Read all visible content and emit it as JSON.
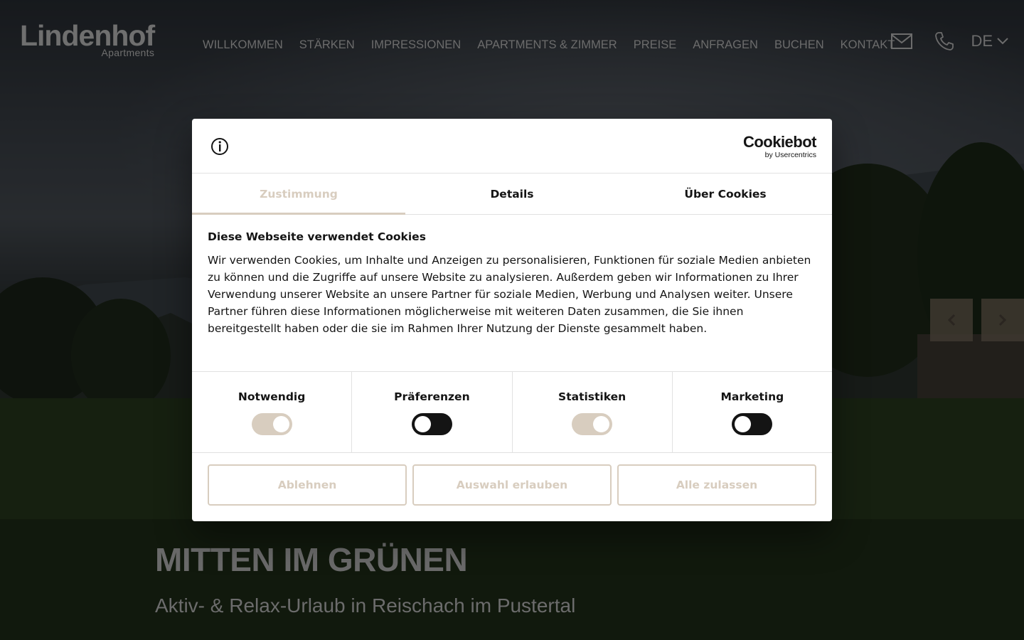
{
  "header": {
    "logo_main": "Lindenhof",
    "logo_sub": "Apartments",
    "nav": [
      "WILLKOMMEN",
      "STÄRKEN",
      "IMPRESSIONEN",
      "APARTMENTS & ZIMMER",
      "PREISE",
      "ANFRAGEN",
      "BUCHEN",
      "KONTAKT"
    ],
    "language": "DE"
  },
  "hero": {
    "title": "MITTEN IM GRÜNEN",
    "subtitle": "Aktiv- & Relax-Urlaub in Reischach im Pustertal"
  },
  "cookie_dialog": {
    "brand": "Cookiebot",
    "brand_sub": "by Usercentrics",
    "tabs": [
      {
        "label": "Zustimmung",
        "active": true
      },
      {
        "label": "Details",
        "active": false
      },
      {
        "label": "Über Cookies",
        "active": false
      }
    ],
    "heading": "Diese Webseite verwendet Cookies",
    "text": "Wir verwenden Cookies, um Inhalte und Anzeigen zu personalisieren, Funktionen für soziale Medien anbieten zu können und die Zugriffe auf unsere Website zu analysieren. Außerdem geben wir Informationen zu Ihrer Verwendung unserer Website an unsere Partner für soziale Medien, Werbung und Analysen weiter. Unsere Partner führen diese Informationen möglicherweise mit weiteren Daten zusammen, die Sie ihnen bereitgestellt haben oder die sie im Rahmen Ihrer Nutzung der Dienste gesammelt haben.",
    "categories": [
      {
        "label": "Notwendig",
        "on": true
      },
      {
        "label": "Präferenzen",
        "on": false
      },
      {
        "label": "Statistiken",
        "on": true
      },
      {
        "label": "Marketing",
        "on": false
      }
    ],
    "buttons": {
      "decline": "Ablehnen",
      "allow_selection": "Auswahl erlauben",
      "allow_all": "Alle zulassen"
    }
  },
  "colors": {
    "accent": "#d8cdbf",
    "text": "#141414",
    "toggle_off": "#141414"
  }
}
